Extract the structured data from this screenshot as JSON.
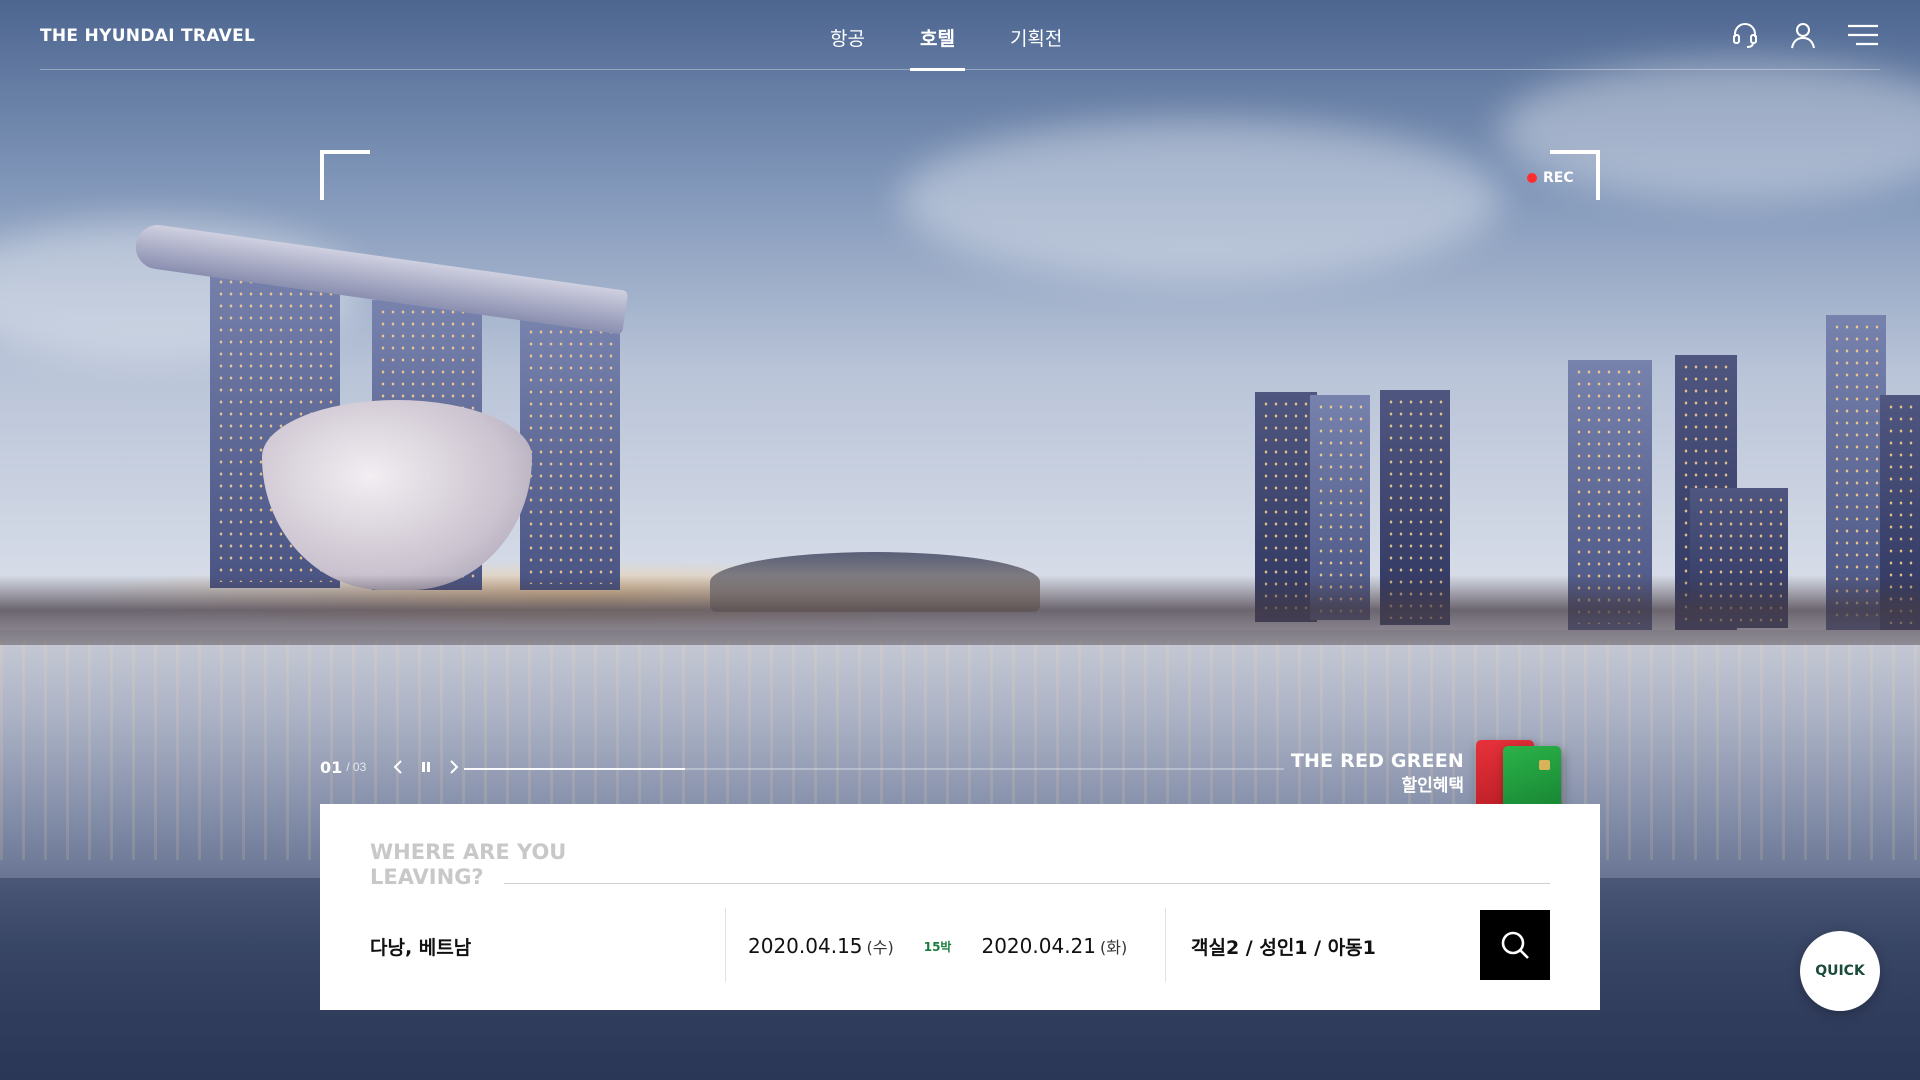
{
  "brand": {
    "logo_text": "THE HYUNDAI TRAVEL"
  },
  "nav": {
    "items": [
      {
        "label": "항공",
        "active": false
      },
      {
        "label": "호텔",
        "active": true
      },
      {
        "label": "기획전",
        "active": false
      }
    ]
  },
  "header_icons": [
    "headset-icon",
    "user-icon",
    "menu-icon"
  ],
  "viewfinder": {
    "rec_label": "REC",
    "rec_color": "#ff2f2f"
  },
  "slider": {
    "current": "01",
    "total": "/ 03",
    "progress_fraction": 0.27,
    "controls": [
      "chevron-left-icon",
      "pause-icon",
      "chevron-right-icon"
    ]
  },
  "promo": {
    "title": "THE RED GREEN",
    "subtitle": "할인혜택",
    "card_colors": {
      "red": "#d42a33",
      "green": "#1f9a3c"
    }
  },
  "search": {
    "prompt_line1": "WHERE ARE YOU",
    "prompt_line2": "LEAVING?",
    "destination": "다낭, 베트남",
    "checkin_date": "2020.04.15",
    "checkin_dow": "(수)",
    "nights": "15박",
    "checkout_date": "2020.04.21",
    "checkout_dow": "(화)",
    "guests": "객실2 / 성인1 / 아동1",
    "search_icon": "search-icon"
  },
  "quick": {
    "label": "QUICK"
  }
}
